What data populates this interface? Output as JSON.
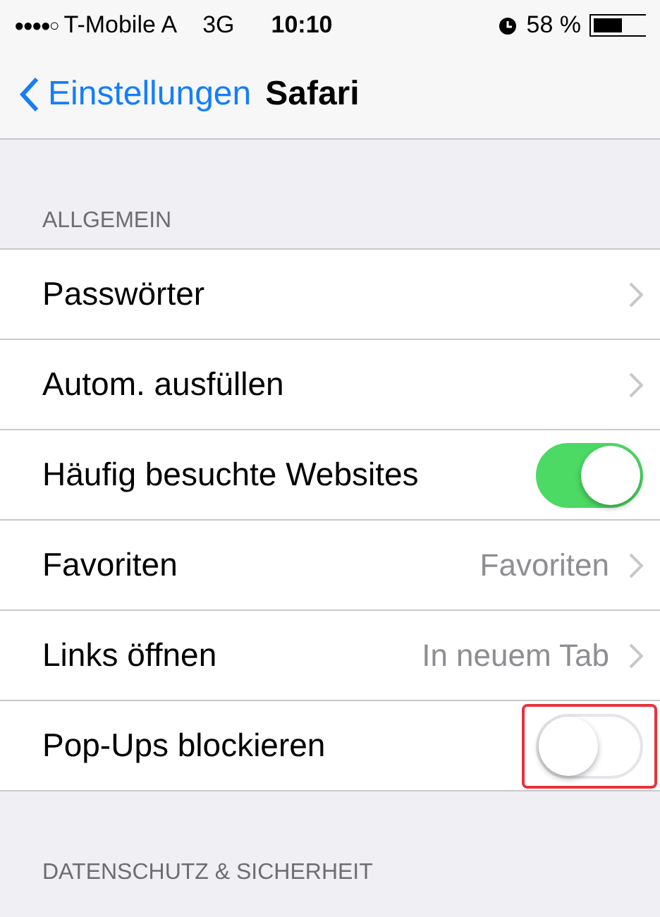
{
  "status_bar": {
    "signal_dots": "●●●●○",
    "carrier": "T-Mobile A",
    "network": "3G",
    "time": "10:10",
    "battery": "58 %"
  },
  "nav_bar": {
    "back": "Einstellungen",
    "title": "Safari"
  },
  "sections": [
    {
      "header": "ALLGEMEIN",
      "rows": [
        {
          "kind": "link",
          "label": "Passwörter"
        },
        {
          "kind": "link",
          "label": "Autom. ausfüllen"
        },
        {
          "kind": "toggle",
          "label": "Häufig besuchte Websites",
          "on": true,
          "highlighted": false
        },
        {
          "kind": "link",
          "label": "Favoriten",
          "value": "Favoriten"
        },
        {
          "kind": "link",
          "label": "Links öffnen",
          "value": "In neuem Tab"
        },
        {
          "kind": "toggle",
          "label": "Pop-Ups blockieren",
          "on": false,
          "highlighted": true
        }
      ]
    },
    {
      "header": "DATENSCHUTZ & SICHERHEIT"
    }
  ]
}
